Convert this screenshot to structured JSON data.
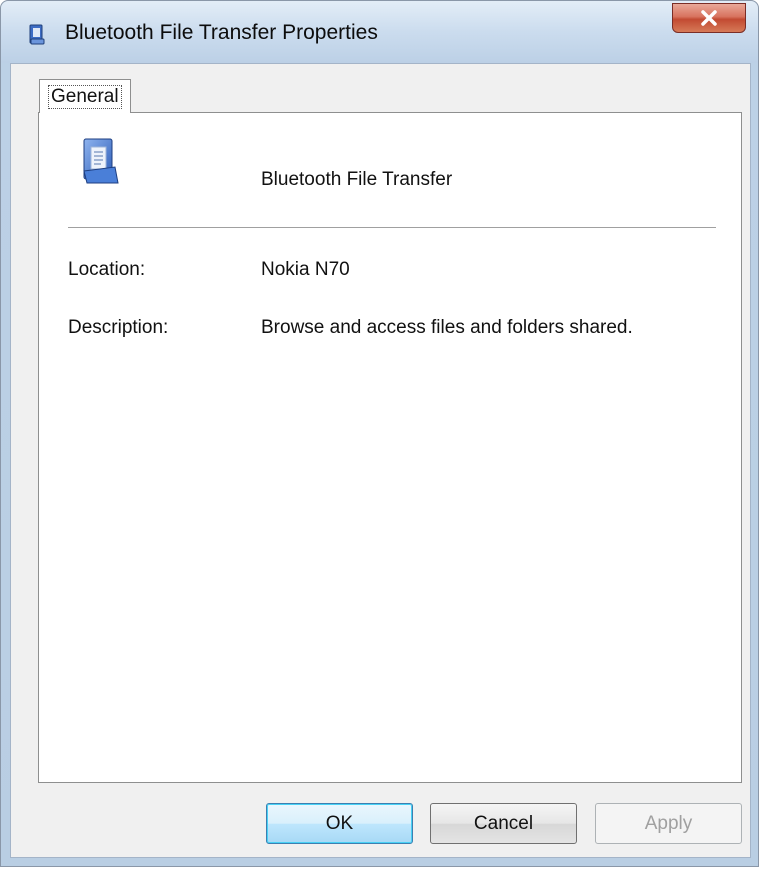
{
  "window": {
    "title": "Bluetooth File Transfer Properties",
    "title_icon": "bluetooth-folder-icon",
    "close_icon": "close-icon",
    "close_color": "#c8462f"
  },
  "tabs": [
    {
      "label": "General",
      "selected": true
    }
  ],
  "general": {
    "icon": "bluetooth-folder-icon",
    "device_name": "Bluetooth File Transfer",
    "properties": [
      {
        "label": "Location:",
        "value": "Nokia N70"
      },
      {
        "label": "Description:",
        "value": "Browse and access files and folders shared."
      }
    ]
  },
  "buttons": {
    "ok_label": "OK",
    "cancel_label": "Cancel",
    "apply_label": "Apply",
    "apply_enabled": false,
    "default_accent": "#3c7fb1"
  }
}
